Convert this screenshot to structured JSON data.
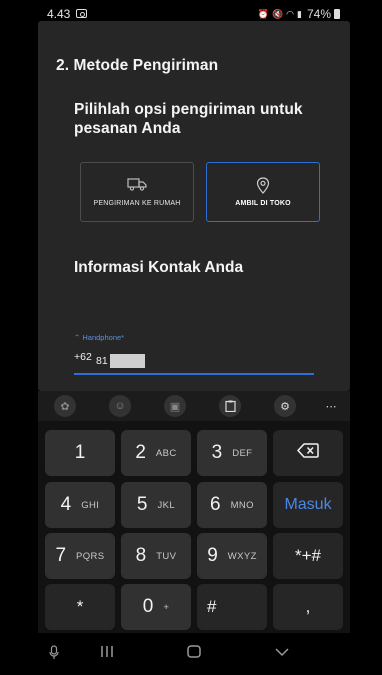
{
  "status_bar": {
    "time": "4.43",
    "battery": "74%"
  },
  "page": {
    "section_title": "2. Metode Pengiriman",
    "question": "Pilihlah opsi pengiriman untuk pesanan Anda",
    "options": [
      {
        "label": "PENGIRIMAN KE RUMAH",
        "icon": "truck-icon",
        "selected": false
      },
      {
        "label": "AMBIL DI TOKO",
        "icon": "location-pin-icon",
        "selected": true
      }
    ],
    "contact_title": "Informasi Kontak Anda",
    "phone": {
      "label": "Handphone*",
      "prefix": "+62",
      "value": "81"
    }
  },
  "keyboard": {
    "toolbar": [
      "emoji-icon",
      "sticker-icon",
      "gif-icon",
      "clipboard-icon",
      "settings-icon",
      "more-icon"
    ],
    "keys": [
      {
        "num": "1",
        "letters": ""
      },
      {
        "num": "2",
        "letters": "ABC"
      },
      {
        "num": "3",
        "letters": "DEF"
      },
      {
        "num": "4",
        "letters": "GHI"
      },
      {
        "num": "5",
        "letters": "JKL"
      },
      {
        "num": "6",
        "letters": "MNO"
      },
      {
        "num": "7",
        "letters": "PQRS"
      },
      {
        "num": "8",
        "letters": "TUV"
      },
      {
        "num": "9",
        "letters": "WXYZ"
      },
      {
        "num": "0",
        "letters": "+"
      }
    ],
    "special": {
      "enter_label": "Masuk",
      "symbols_label": "*+#",
      "star": "*",
      "hash": "#",
      "comma": ","
    },
    "accent_color": "#4b87e8"
  },
  "colors": {
    "selected_border": "#2e6fd6",
    "background": "#262626"
  }
}
